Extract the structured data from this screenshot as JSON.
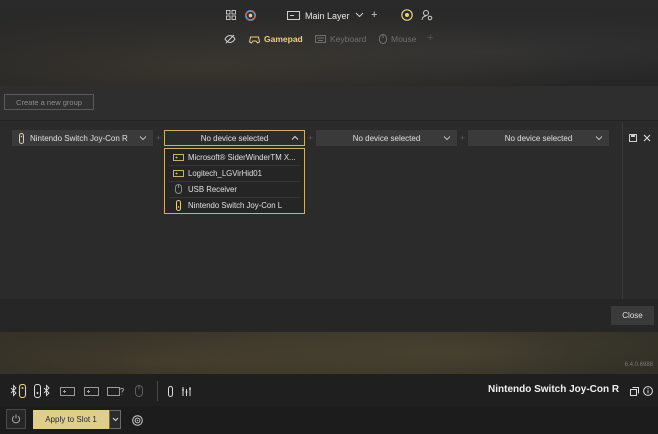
{
  "topbar": {
    "layer_label": "Main Layer",
    "tabs": [
      {
        "label": "Gamepad",
        "active": true
      },
      {
        "label": "Keyboard",
        "active": false
      },
      {
        "label": "Mouse",
        "active": false
      }
    ],
    "accent_color": "#e8cf84"
  },
  "panel": {
    "create_group_label": "Create a new group",
    "selectors": [
      {
        "value": "Nintendo Switch Joy-Con R"
      },
      {
        "value": "No device selected",
        "open": true
      },
      {
        "value": "No device selected"
      },
      {
        "value": "No device selected"
      }
    ],
    "dropdown_options": [
      {
        "label": "Microsoft® SiderWinderTM X...",
        "icon": "gamepad-icon"
      },
      {
        "label": "Logitech_LGVirHid01",
        "icon": "gamepad-icon"
      },
      {
        "label": "USB Receiver",
        "icon": "mouse-icon"
      },
      {
        "label": "Nintendo Switch Joy-Con L",
        "icon": "joycon-icon"
      }
    ],
    "close_label": "Close"
  },
  "version": "6.4.0.6988",
  "bottom": {
    "device_name": "Nintendo Switch Joy-Con R",
    "apply_label": "Apply to Slot 1"
  }
}
